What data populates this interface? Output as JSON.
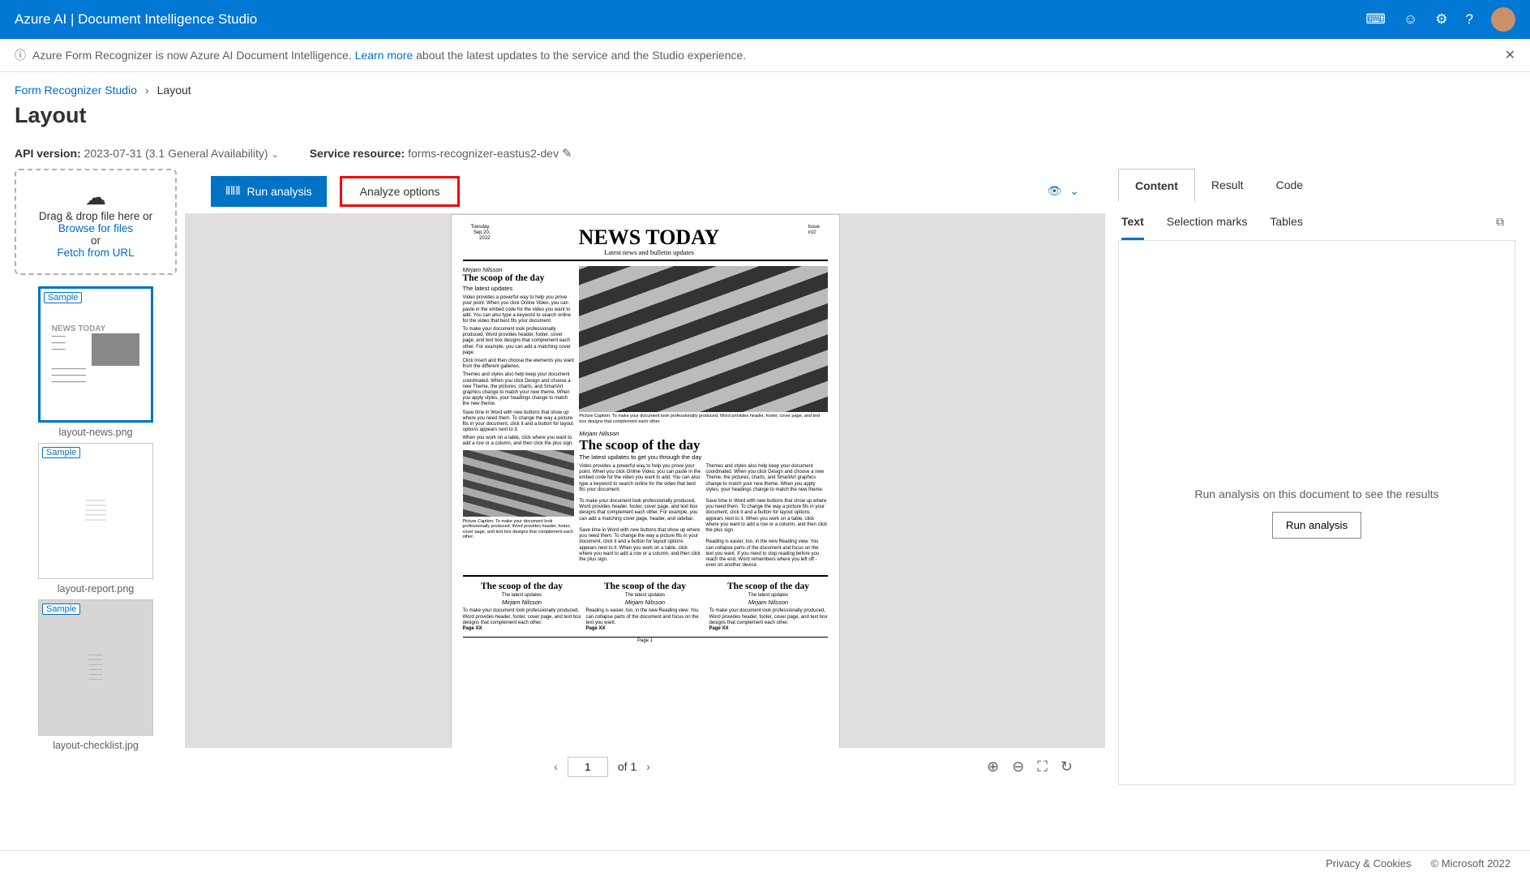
{
  "header": {
    "app_title": "Azure AI | Document Intelligence Studio"
  },
  "banner": {
    "pre_text": "Azure Form Recognizer is now Azure AI Document Intelligence. ",
    "link": "Learn more",
    "post_text": " about the latest updates to the service and the Studio experience."
  },
  "breadcrumb": {
    "root": "Form Recognizer Studio",
    "current": "Layout"
  },
  "page_title": "Layout",
  "config": {
    "api_label": "API version:",
    "api_value": "2023-07-31 (3.1 General Availability)",
    "resource_label": "Service resource:",
    "resource_value": "forms-recognizer-eastus2-dev"
  },
  "drop": {
    "line1": "Drag & drop file here or",
    "browse": "Browse for files",
    "or": "or",
    "fetch": "Fetch from URL"
  },
  "thumbs": [
    {
      "name": "layout-news.png",
      "tag": "Sample",
      "selected": true
    },
    {
      "name": "layout-report.png",
      "tag": "Sample",
      "selected": false
    },
    {
      "name": "layout-checklist.jpg",
      "tag": "Sample",
      "selected": false
    }
  ],
  "toolbar": {
    "run": "Run analysis",
    "analyze": "Analyze options"
  },
  "doc": {
    "date": "Tuesday, Sep 20, 2022",
    "masthead": "NEWS TODAY",
    "issue": "Issue #10",
    "subtitle": "Latest news and bulletin updates",
    "author": "Mirjam Nilsson",
    "scoop_title": "The scoop of the day",
    "sub_updates": "The latest updates",
    "sub_updates2": "The latest updates to get you through the day",
    "page_footer": "Page 1",
    "page_x": "Page XX"
  },
  "pager": {
    "page_value": "1",
    "of": "of 1"
  },
  "right": {
    "tabs": [
      "Content",
      "Result",
      "Code"
    ],
    "sub_tabs": [
      "Text",
      "Selection marks",
      "Tables"
    ],
    "empty": "Run analysis on this document to see the results",
    "run": "Run analysis"
  },
  "footer": {
    "privacy": "Privacy & Cookies",
    "copyright": "© Microsoft 2022"
  }
}
